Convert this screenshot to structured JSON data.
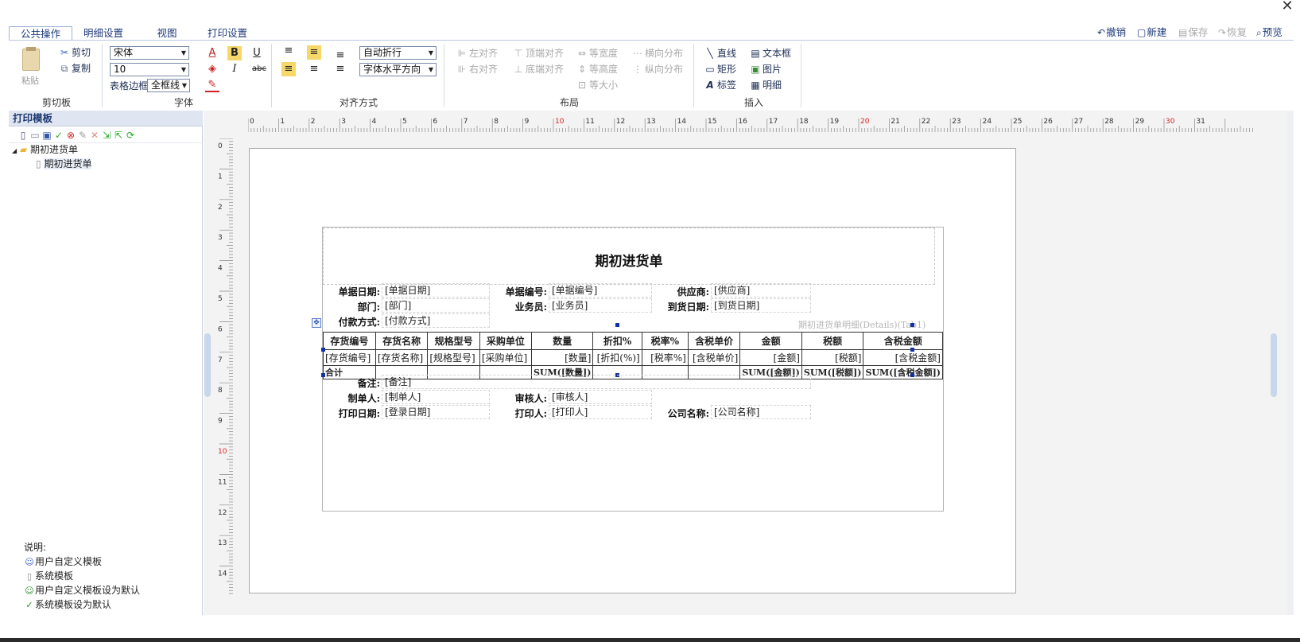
{
  "window": {
    "close_glyph": "✕"
  },
  "tabs": [
    "公共操作",
    "明细设置",
    "视图",
    "打印设置"
  ],
  "actions": [
    {
      "label": "撤销",
      "icon": "undo-icon",
      "glyph": "↶",
      "enabled": true
    },
    {
      "label": "新建",
      "icon": "new-icon",
      "glyph": "▢",
      "enabled": true
    },
    {
      "label": "保存",
      "icon": "save-icon",
      "glyph": "▤",
      "enabled": false
    },
    {
      "label": "恢复",
      "icon": "redo-icon",
      "glyph": "↷",
      "enabled": false
    },
    {
      "label": "预览",
      "icon": "preview-icon",
      "glyph": "⌕",
      "enabled": true
    }
  ],
  "ribbon": {
    "clipboard": {
      "caption": "剪切板",
      "paste": "粘贴",
      "cut": "剪切",
      "copy": "复制"
    },
    "font": {
      "caption": "字体",
      "family": "宋体",
      "size": "10",
      "border_label": "表格边框",
      "border_value": "全框线",
      "underline": "U",
      "bold": "B",
      "italic": "I",
      "strike": "abc"
    },
    "align": {
      "caption": "对齐方式",
      "wrap": "自动折行",
      "direction": "字体水平方向"
    },
    "layout": {
      "caption": "布局",
      "items": [
        "左对齐",
        "顶端对齐",
        "等宽度",
        "横向分布",
        "右对齐",
        "底端对齐",
        "等高度",
        "纵向分布",
        "等大小"
      ]
    },
    "insert": {
      "caption": "插入",
      "items": [
        "直线",
        "文本框",
        "矩形",
        "图片",
        "标签",
        "明细"
      ]
    }
  },
  "left_panel": {
    "title": "打印模板",
    "tree": {
      "folder": "期初进货单",
      "child": "期初进货单"
    },
    "legend_title": "说明:",
    "legend": [
      "用户自定义模板",
      "系统模板",
      "用户自定义模板设为默认",
      "系统模板设为默认"
    ]
  },
  "rulers": {
    "h_ticks": [
      "0",
      "1",
      "2",
      "3",
      "4",
      "5",
      "6",
      "7",
      "8",
      "9",
      "10",
      "11",
      "12",
      "13",
      "14",
      "15",
      "16",
      "17",
      "18",
      "19",
      "20",
      "21",
      "22",
      "23",
      "24",
      "25",
      "26",
      "27",
      "28",
      "29",
      "30",
      "31"
    ],
    "v_ticks": [
      "0",
      "1",
      "2",
      "3",
      "4",
      "5",
      "6",
      "7",
      "8",
      "9",
      "10",
      "11",
      "12",
      "13",
      "14"
    ],
    "highlight": [
      "10",
      "20",
      "30"
    ]
  },
  "report": {
    "title": "期初进货单",
    "header_fields": [
      {
        "label": "单据日期:",
        "value": "[单据日期]"
      },
      {
        "label": "单据编号:",
        "value": "[单据编号]"
      },
      {
        "label": "供应商:",
        "value": "[供应商]"
      },
      {
        "label": "部门:",
        "value": "[部门]"
      },
      {
        "label": "业务员:",
        "value": "[业务员]"
      },
      {
        "label": "到货日期:",
        "value": "[到货日期]"
      },
      {
        "label": "付款方式:",
        "value": "[付款方式]"
      }
    ],
    "detail_caption": "期初进货单明细(Details)(Tab1)",
    "columns": [
      "存货编号",
      "存货名称",
      "规格型号",
      "采购单位",
      "数量",
      "折扣%",
      "税率%",
      "含税单价",
      "金额",
      "税额",
      "含税金额"
    ],
    "detail_row": [
      "[存货编号]",
      "[存货名称]",
      "[规格型号]",
      "[采购单位]",
      "[数量]",
      "[折扣(%)]",
      "[税率%]",
      "[含税单价]",
      "[金额]",
      "[税额]",
      "[含税金额]"
    ],
    "sum_row": [
      "合计",
      "",
      "",
      "",
      "SUM([数量])",
      "",
      "",
      "",
      "SUM([金额])",
      "SUM([税额])",
      "SUM([含税金额])"
    ],
    "footer_fields": [
      {
        "label": "备注:",
        "value": "[备注]"
      },
      {
        "label": "制单人:",
        "value": "[制单人]"
      },
      {
        "label": "审核人:",
        "value": "[审核人]"
      },
      {
        "label": "打印日期:",
        "value": "[登录日期]"
      },
      {
        "label": "打印人:",
        "value": "[打印人]"
      },
      {
        "label": "公司名称:",
        "value": "[公司名称]"
      }
    ]
  }
}
